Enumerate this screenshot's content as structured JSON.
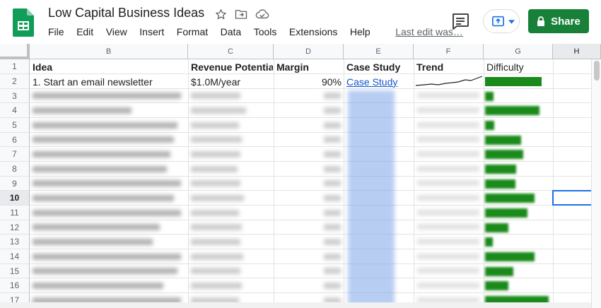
{
  "doc": {
    "title": "Low Capital Business Ideas"
  },
  "menu": [
    "File",
    "Edit",
    "View",
    "Insert",
    "Format",
    "Data",
    "Tools",
    "Extensions",
    "Help"
  ],
  "last_edit": "Last edit was…",
  "share_label": "Share",
  "colors": {
    "brand_green": "#188038",
    "sheets_green": "#0f9d58",
    "bar_green": "#1a8a1a",
    "link_blue": "#1155cc",
    "selection_blue": "#1a73e8"
  },
  "icons": [
    "sheets-logo-icon",
    "star-icon",
    "move-to-folder-icon",
    "cloud-status-icon",
    "comment-icon",
    "present-icon",
    "dropdown-arrow-icon",
    "lock-icon"
  ],
  "columns": [
    "B",
    "C",
    "D",
    "E",
    "F",
    "G",
    "H"
  ],
  "rows": [
    "1",
    "2",
    "3",
    "4",
    "5",
    "6",
    "7",
    "8",
    "9",
    "10",
    "11",
    "12",
    "13",
    "14",
    "15",
    "16",
    "17"
  ],
  "active_row": "10",
  "header_row": {
    "idea": "Idea",
    "revenue": "Revenue Potential",
    "margin": "Margin",
    "case_study": "Case Study",
    "trend": "Trend",
    "difficulty": "Difficulty"
  },
  "first_row": {
    "idea": "1. Start an email newsletter",
    "revenue": "$1.0M/year",
    "margin": "90%",
    "case_study": "Case Study"
  },
  "difficulty_levels": [
    0.83,
    0.13,
    0.8,
    0.14,
    0.53,
    0.56,
    0.46,
    0.45,
    0.73,
    0.62,
    0.34,
    0.11,
    0.73,
    0.42,
    0.34,
    0.94
  ]
}
